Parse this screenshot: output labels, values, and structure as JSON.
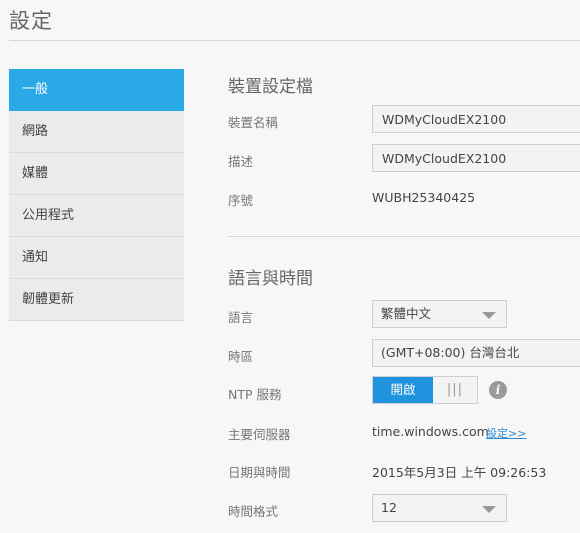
{
  "page": {
    "title": "設定"
  },
  "sidebar": {
    "items": [
      {
        "label": "一般"
      },
      {
        "label": "網路"
      },
      {
        "label": "媒體"
      },
      {
        "label": "公用程式"
      },
      {
        "label": "通知"
      },
      {
        "label": "韌體更新"
      }
    ],
    "active_index": 0
  },
  "device_profile": {
    "title": "裝置設定檔",
    "name": {
      "label": "裝置名稱",
      "value": "WDMyCloudEX2100"
    },
    "description": {
      "label": "描述",
      "value": "WDMyCloudEX2100"
    },
    "serial": {
      "label": "序號",
      "value": "WUBH25340425"
    }
  },
  "language_time": {
    "title": "語言與時間",
    "language": {
      "label": "語言",
      "value": "繁體中文"
    },
    "timezone": {
      "label": "時區",
      "value": "(GMT+08:00) 台灣台北"
    },
    "ntp": {
      "label": "NTP 服務",
      "toggle_label": "開啟",
      "grip": "|||",
      "state": "on"
    },
    "primary_server": {
      "label": "主要伺服器",
      "value": "time.windows.com",
      "link": "設定>>"
    },
    "datetime": {
      "label": "日期與時間",
      "value": "2015年5月3日 上午 09:26:53"
    },
    "time_format": {
      "label": "時間格式",
      "value": "12"
    }
  },
  "colors": {
    "accent": "#29a9e6",
    "toggle_on": "#1f93dd",
    "link": "#2a8ad6"
  },
  "icons": {
    "info": "info-icon",
    "dropdown": "chevron-down-icon"
  }
}
